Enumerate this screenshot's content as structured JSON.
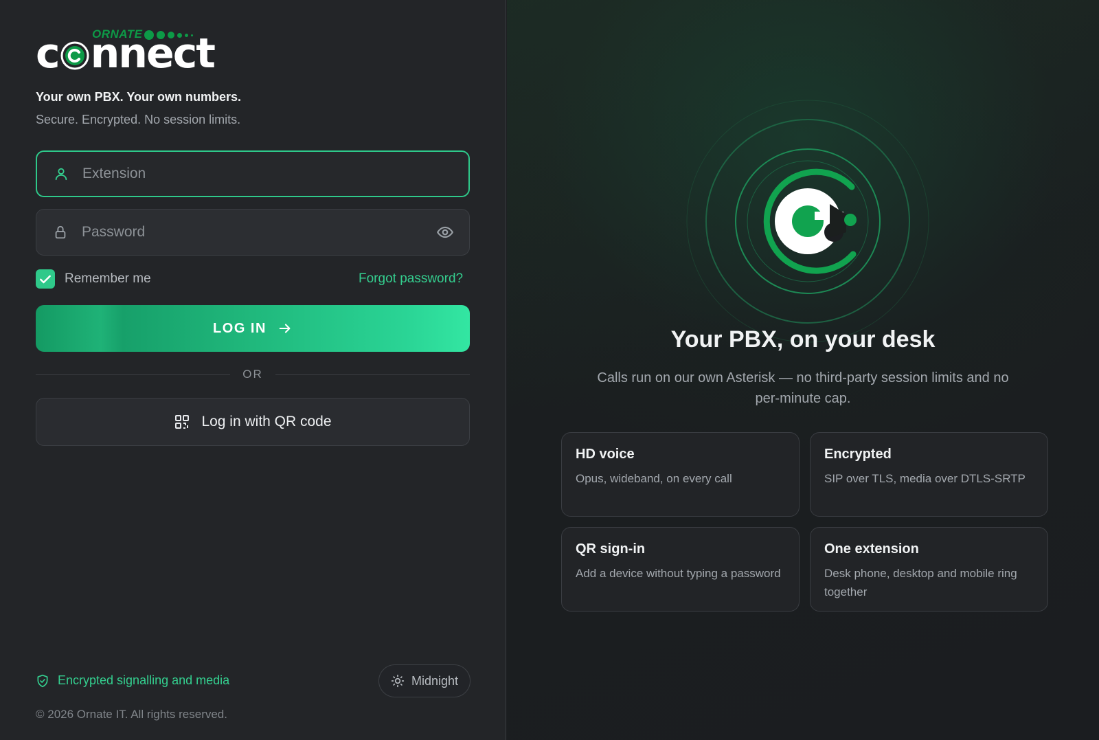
{
  "brand": {
    "ornate": "ORNATE",
    "wordmark_before": "c",
    "wordmark_after": "nnect",
    "tagline": "Your own PBX. Your own numbers.",
    "subline": "Secure. Encrypted. No session limits.",
    "accent_color": "#2fc98a",
    "brand_green": "#0d9a47"
  },
  "login_form": {
    "extension_placeholder": "Extension",
    "extension_value": "",
    "password_placeholder": "Password",
    "password_value": "",
    "remember_label": "Remember me",
    "remember_checked": true,
    "forgot_label": "Forgot password?",
    "login_label": "LOG IN",
    "or_label": "OR",
    "qr_label": "Log in with QR code"
  },
  "footer": {
    "encrypted_label": "Encrypted signalling and media",
    "theme_label": "Midnight",
    "copyright": "© 2026 Ornate IT. All rights reserved."
  },
  "hero": {
    "title": "Your PBX, on your desk",
    "subtitle": "Calls run on our own Asterisk — no third-party session limits and no per-minute cap.",
    "features": [
      {
        "title": "HD voice",
        "desc": "Opus, wideband, on every call"
      },
      {
        "title": "Encrypted",
        "desc": "SIP over TLS, media over DTLS-SRTP"
      },
      {
        "title": "QR sign-in",
        "desc": "Add a device without typing a password"
      },
      {
        "title": "One extension",
        "desc": "Desk phone, desktop and mobile ring together"
      }
    ]
  },
  "icons": {
    "extension": "user-icon",
    "password": "lock-icon",
    "reveal": "eye-icon",
    "login_arrow": "arrow-right-icon",
    "qr": "qr-code-icon",
    "encrypted": "shield-check-icon",
    "theme": "sun-icon",
    "hero": "connect-logo-icon"
  }
}
